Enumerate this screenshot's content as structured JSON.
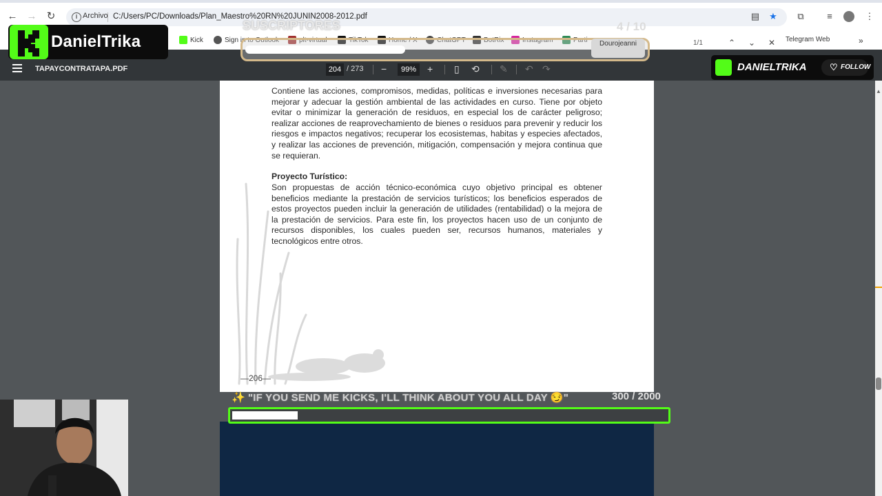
{
  "browser": {
    "url_chip": "Archivo",
    "url": "C:/Users/PC/Downloads/Plan_Maestro%20RN%20JUNIN2008-2012.pdf"
  },
  "bookmarks": [
    {
      "label": "Kick",
      "color": "#53fc18"
    },
    {
      "label": "Sign in to Outlook",
      "color": "#555555"
    },
    {
      "label": "plt-virtual",
      "color": "#a03030"
    },
    {
      "label": "TikTok",
      "color": "#111111"
    },
    {
      "label": "Home / X",
      "color": "#111111"
    },
    {
      "label": "ChatGPT",
      "color": "#444444"
    },
    {
      "label": "BotRix",
      "color": "#333333"
    },
    {
      "label": "Instagram",
      "color": "#d6249f"
    },
    {
      "label": "Parti",
      "color": "#2e8b57"
    },
    {
      "label": "Telegram Web",
      "color": "#2aa1da"
    }
  ],
  "find": {
    "count": "1/1"
  },
  "pdf_toolbar": {
    "title": "TAPAYCONTRATAPA.PDF",
    "page": "204",
    "total": "/ 273",
    "zoom": "99%"
  },
  "pdf_page": {
    "paragraph1": "Contiene las acciones, compromisos, medidas, políticas e inversiones necesarias para mejorar y adecuar la gestión ambiental de las actividades en curso. Tiene por objeto evitar o minimizar la generación de residuos, en especial los de carácter peligroso; realizar acciones de reaprovechamiento de bienes o residuos para prevenir y reducir los riesgos e impactos negativos; recuperar los ecosistemas, habitas y especies afectados, y realizar las acciones de prevención, mitigación, compensación y mejora continua que se requieran.",
    "heading": "Proyecto Turístico:",
    "paragraph2": "Son propuestas de acción técnico-económica cuyo objetivo principal es obtener beneficios mediante la prestación de servicios turísticos; los beneficios esperados de estos proyectos pueden incluir la generación de utilidades (rentabilidad) o la mejora de la prestación de servicios. Para este fin, los proyectos hacen uso de un conjunto de recursos disponibles, los cuales pueden ser, recursos humanos, materiales y tecnológicos entre otros.",
    "page_number": "—206—"
  },
  "overlays": {
    "logo_name": "DanielTrika",
    "goal_title": "SUSCRIPTORES",
    "goal_count": "4 / 10",
    "goal_progress": 0.4,
    "goal_user": "Dourojeanni",
    "follow_name": "DANIELTRIKA",
    "follow_label": "FOLLOW",
    "kick_message": "\"IF YOU SEND ME KICKS, I'LL THINK ABOUT YOU ALL DAY 😏\"",
    "kick_count": "300 / 2000",
    "kick_progress": 0.15
  }
}
